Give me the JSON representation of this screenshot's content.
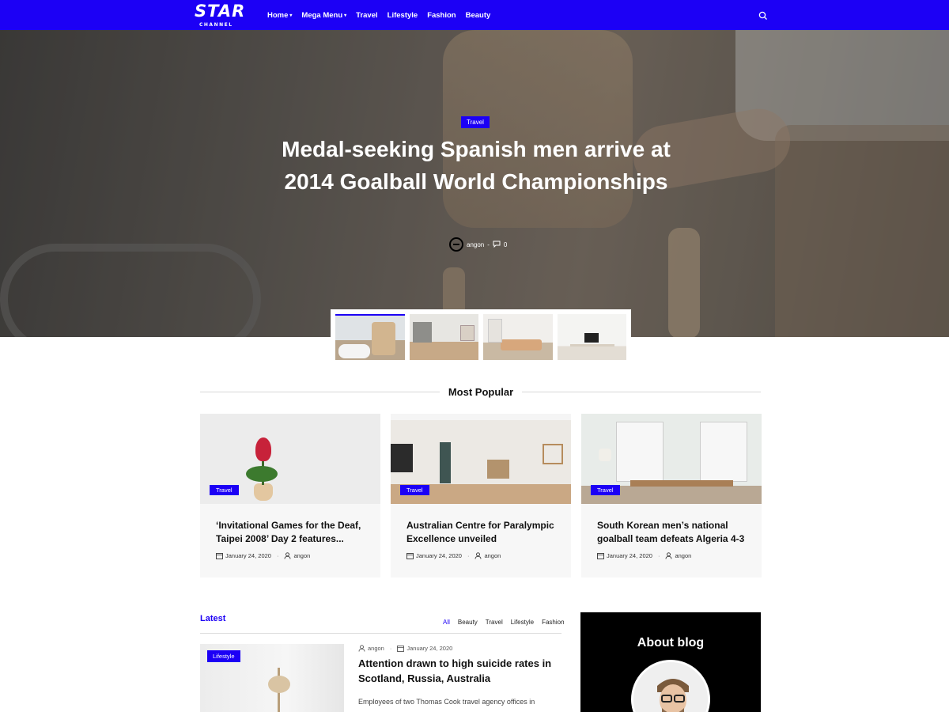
{
  "brand": {
    "logo_text": "STAR",
    "logo_sub": "CHANNEL"
  },
  "nav": [
    {
      "label": "Home",
      "dropdown": true
    },
    {
      "label": "Mega Menu",
      "dropdown": true
    },
    {
      "label": "Travel",
      "dropdown": false
    },
    {
      "label": "Lifestyle",
      "dropdown": false
    },
    {
      "label": "Fashion",
      "dropdown": false
    },
    {
      "label": "Beauty",
      "dropdown": false
    }
  ],
  "hero": {
    "category": "Travel",
    "title": "Medal-seeking Spanish men arrive at 2014 Goalball World Championships",
    "author": "angon",
    "separator": "-",
    "comments": "0"
  },
  "most_popular": {
    "title": "Most Popular",
    "cards": [
      {
        "category": "Travel",
        "title": "‘Invitational Games for the Deaf, Taipei 2008’ Day 2 features...",
        "date": "January 24, 2020",
        "author": "angon"
      },
      {
        "category": "Travel",
        "title": "Australian Centre for Paralympic Excellence unveiled",
        "date": "January 24, 2020",
        "author": "angon"
      },
      {
        "category": "Travel",
        "title": "South Korean men’s national goalball team defeats Algeria 4-3",
        "date": "January 24, 2020",
        "author": "angon"
      }
    ]
  },
  "latest": {
    "title": "Latest",
    "tabs": [
      "All",
      "Beauty",
      "Travel",
      "Lifestyle",
      "Fashion"
    ],
    "active_tab": "All",
    "post": {
      "category": "Lifestyle",
      "author": "angon",
      "date": "January 24, 2020",
      "title": "Attention drawn to high suicide rates in Scotland, Russia, Australia",
      "excerpt": "Employees of two Thomas Cook travel agency offices in"
    }
  },
  "about": {
    "title": "About blog"
  },
  "colors": {
    "accent": "#1c00f5",
    "header_bg": "#1c00f5",
    "about_bg": "#000000"
  },
  "icons": [
    "search-icon",
    "calendar-icon",
    "user-icon",
    "comment-icon",
    "chevron-down-icon"
  ]
}
